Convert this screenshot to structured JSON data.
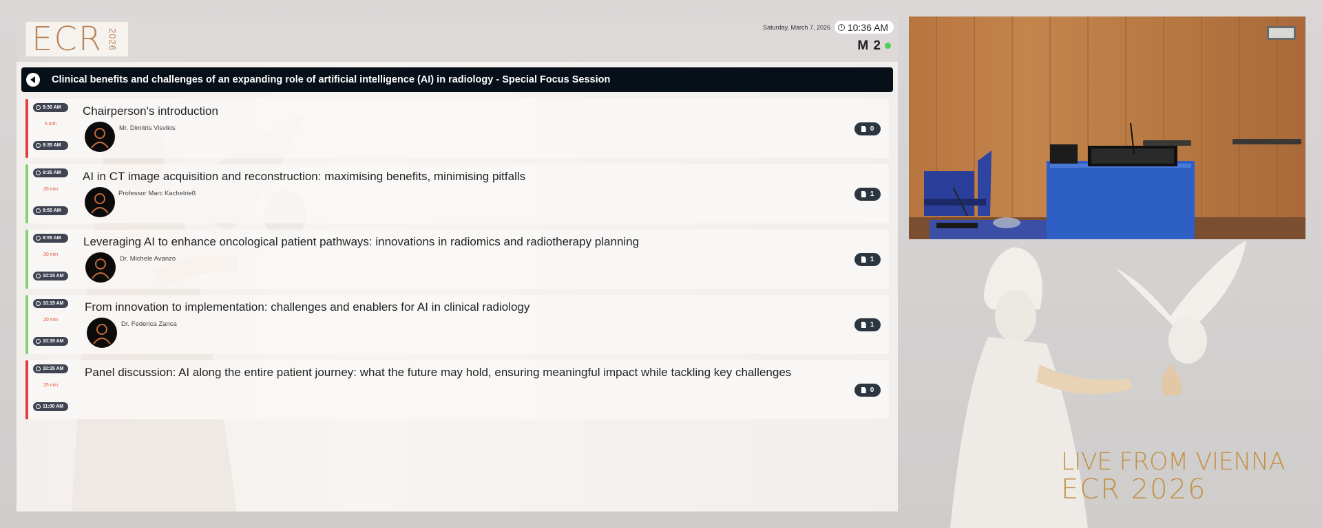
{
  "header": {
    "logo_text": "ECR",
    "logo_year": "2026",
    "date": "Saturday, March 7, 2026",
    "time": "10:36 AM",
    "room": "M 2"
  },
  "session": {
    "title": "Clinical benefits and challenges of an expanding role of artificial intelligence (AI) in radiology - Special Focus Session"
  },
  "talks": [
    {
      "start": "9:30 AM",
      "end": "9:35 AM",
      "duration": "5 min",
      "title": "Chairperson's introduction",
      "speaker": "Mr. Dimitris Visvikis",
      "docs": "0",
      "accent": "#e53b3b"
    },
    {
      "start": "9:35 AM",
      "end": "9:55 AM",
      "duration": "20 min",
      "title": "AI in CT image acquisition and reconstruction: maximising benefits, minimising pitfalls",
      "speaker": "Professor Marc Kachelrieß",
      "docs": "1",
      "accent": "#7fd36e"
    },
    {
      "start": "9:55 AM",
      "end": "10:15 AM",
      "duration": "20 min",
      "title": "Leveraging AI to enhance oncological patient pathways: innovations in radiomics and radiotherapy planning",
      "speaker": "Dr. Michele Avanzo",
      "docs": "1",
      "accent": "#7fd36e"
    },
    {
      "start": "10:15 AM",
      "end": "10:35 AM",
      "duration": "20 min",
      "title": "From innovation to implementation: challenges and enablers for AI in clinical radiology",
      "speaker": "Dr. Federica Zanca",
      "docs": "1",
      "accent": "#7fd36e"
    },
    {
      "start": "10:35 AM",
      "end": "11:00 AM",
      "duration": "25 min",
      "title": "Panel discussion: AI along the entire patient journey: what the future may hold, ensuring meaningful impact while tackling key challenges",
      "speaker": "",
      "docs": "0",
      "accent": "#e53b3b"
    }
  ],
  "branding": {
    "live_text": "LIVE FROM VIENNA",
    "event_text": "ECR 2026",
    "gold": "#c39146"
  }
}
